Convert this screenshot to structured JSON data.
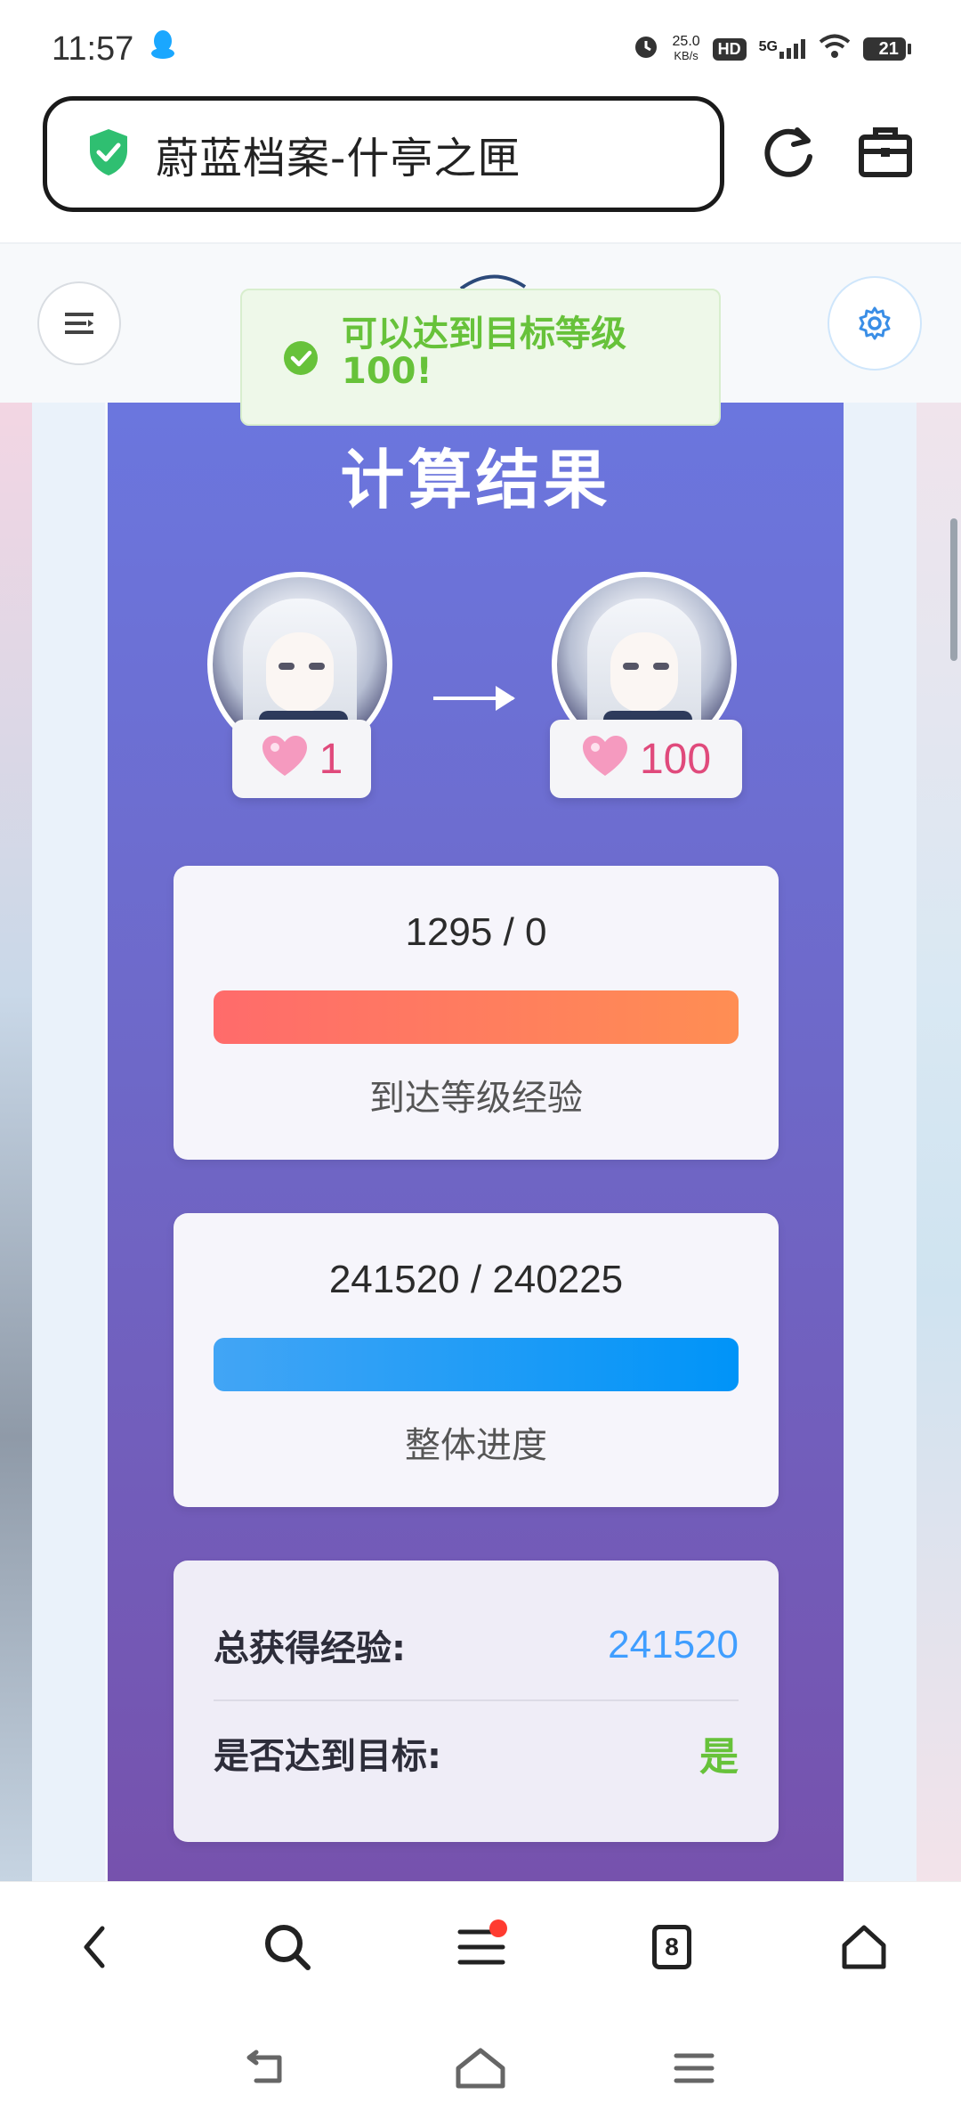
{
  "status_bar": {
    "time": "11:57",
    "net_speed_value": "25.0",
    "net_speed_unit": "KB/s",
    "hd_label": "HD",
    "network_label": "5G",
    "battery_level": "21"
  },
  "browser": {
    "url_text": "蔚蓝档案-什亭之匣",
    "tab_count": "8"
  },
  "toast": {
    "message": "可以达到目标等级100!",
    "color": "#67c23a"
  },
  "result": {
    "title": "计算结果",
    "current_level": "1",
    "target_level": "100",
    "level_card": {
      "value": "1295 / 0",
      "label": "到达等级经验",
      "progress": 1.0
    },
    "overall_card": {
      "value": "241520 / 240225",
      "label": "整体进度",
      "progress": 1.0
    },
    "stats": {
      "total_exp_label": "总获得经验:",
      "total_exp_value": "241520",
      "reached_label": "是否达到目标:",
      "reached_value": "是"
    }
  },
  "colors": {
    "accent_blue": "#409eff",
    "success_green": "#67c23a",
    "level_pink": "#e04a7c"
  }
}
